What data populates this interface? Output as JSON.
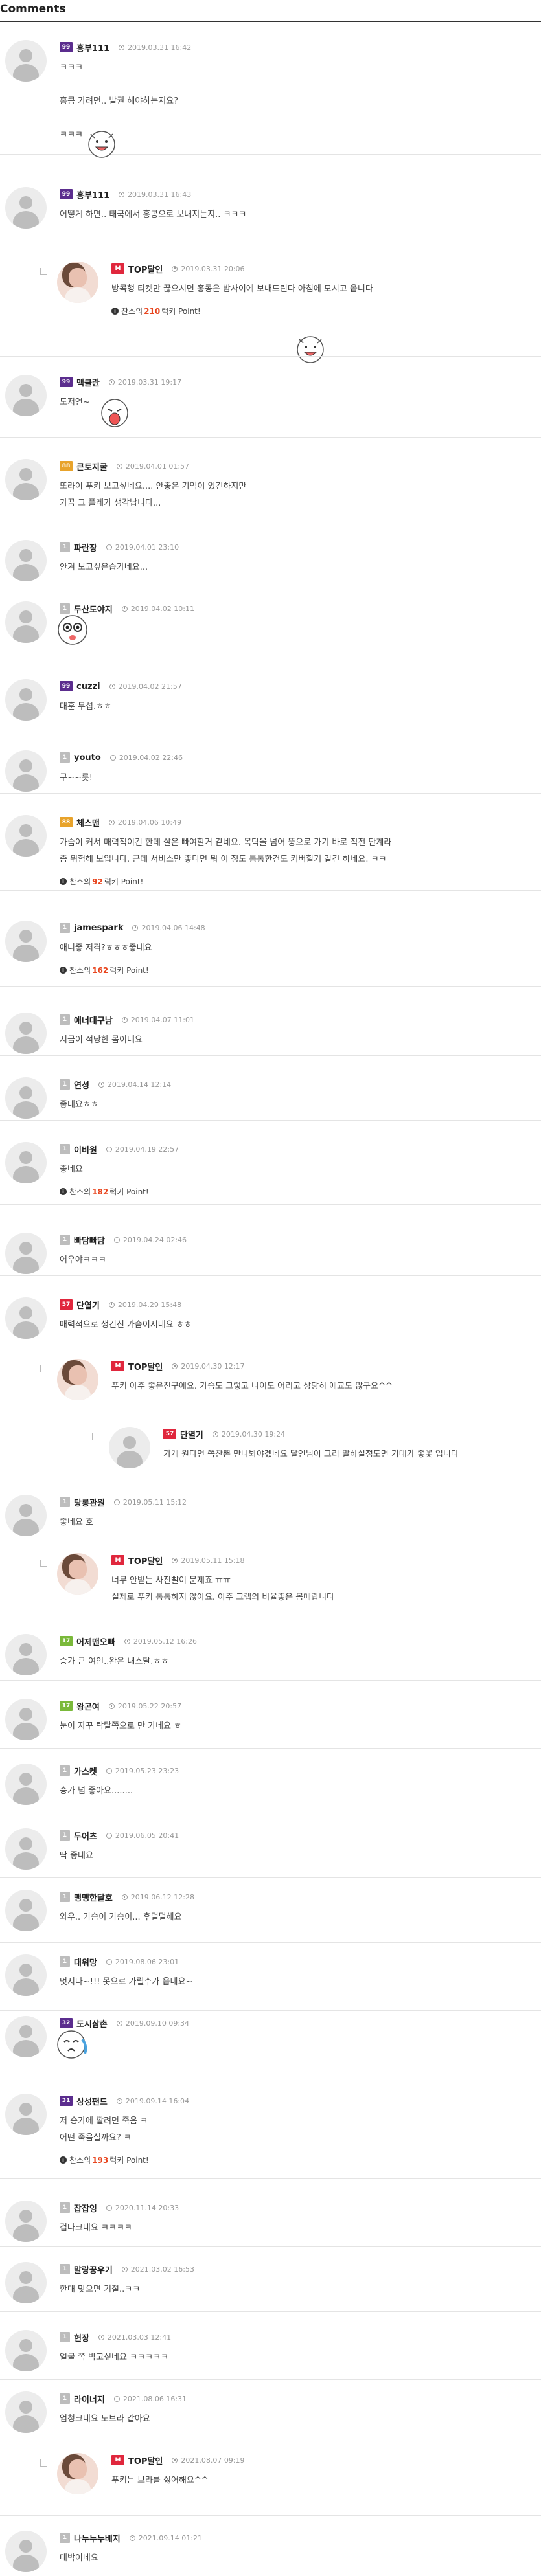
{
  "section_title": "Comments",
  "point_template": {
    "prefix": "찬스의",
    "suffix": "럭키 Point!"
  },
  "level_colors": {
    "99": "#5b2d8e",
    "M": "#e0273d",
    "88": "#e8a32b",
    "57": "#e0273d",
    "17": "#7ab93a",
    "32": "#5b2d8e",
    "31": "#5b2d8e",
    "1": "#bdbdbd"
  },
  "comments": [
    {
      "level": "99",
      "nick": "흥부111",
      "date": "2019.03.31 16:42",
      "lines": [
        "ㅋㅋㅋ",
        "",
        "홍콩 가려면.. 발권 해야하는지요?",
        "",
        "ㅋㅋㅋ"
      ],
      "emoji": "laughing-emoticon"
    },
    {
      "level": "99",
      "nick": "흥부111",
      "date": "2019.03.31 16:43",
      "lines": [
        "어떻게 하면.. 태국에서 홍콩으로 보내지는지.. ㅋㅋㅋ"
      ],
      "emoji": "laughing-emoticon"
    },
    {
      "level": "M",
      "nick": "TOP달인",
      "date": "2019.03.31 20:06",
      "lines": [
        "방콕행 티켓만 끊으시면 홍콩은 밤사이에 보내드린다 아침에 모시고 옵니다"
      ],
      "point": 210
    },
    {
      "level": "99",
      "nick": "맥클란",
      "date": "2019.03.31 19:17",
      "lines": [
        "도저언~"
      ],
      "emoji": "shouting-emoticon"
    },
    {
      "level": "88",
      "nick": "큰토지굴",
      "date": "2019.04.01 01:57",
      "lines": [
        "또라이 푸키 보고싶네요.... 안좋은 기억이 있긴하지만",
        "가끔 그 플레가 생각납니다..."
      ]
    },
    {
      "level": "1",
      "nick": "파란장",
      "date": "2019.04.01 23:10",
      "lines": [
        "안겨 보고싶은습가네요..."
      ]
    },
    {
      "level": "1",
      "nick": "두산도야지",
      "date": "2019.04.02 10:11",
      "lines": [],
      "emoji": "surprised-emoticon"
    },
    {
      "level": "99",
      "nick": "cuzzi",
      "date": "2019.04.02 21:57",
      "lines": [
        "대훈 무섭.ㅎㅎ"
      ]
    },
    {
      "level": "1",
      "nick": "youto",
      "date": "2019.04.02 22:46",
      "lines": [
        "구~~릇!"
      ]
    },
    {
      "level": "88",
      "nick": "체스맨",
      "date": "2019.04.06 10:49",
      "lines": [
        "가슴이 커서 매력적이긴 한데 살은 빠여할거 같네요. 목탁을 넘어 뚱으로 가기 바로 직전 단계라",
        "좀 위험해 보입니다. 근데 서비스만 좋다면 뭐 이 정도 통통한건도 커버할거 같긴 하네요. ㅋㅋ"
      ],
      "point": 92
    },
    {
      "level": "1",
      "nick": "jamespark",
      "date": "2019.04.06 14:48",
      "lines": [
        "애니좋 저격?ㅎㅎㅎ좋네요"
      ],
      "point": 162
    },
    {
      "level": "1",
      "nick": "애너대구남",
      "date": "2019.04.07 11:01",
      "lines": [
        "지금이 적당한 몸이네요"
      ]
    },
    {
      "level": "1",
      "nick": "연성",
      "date": "2019.04.14 12:14",
      "lines": [
        "좋네요ㅎㅎ"
      ]
    },
    {
      "level": "1",
      "nick": "이비원",
      "date": "2019.04.19 22:57",
      "lines": [
        "좋네요"
      ],
      "point": 182
    },
    {
      "level": "1",
      "nick": "빠담빠담",
      "date": "2019.04.24 02:46",
      "lines": [
        "어우야ㅋㅋㅋ"
      ]
    },
    {
      "level": "57",
      "nick": "단열기",
      "date": "2019.04.29 15:48",
      "lines": [
        "매력적으로 생긴신 가슴이시네요 ㅎㅎ"
      ]
    },
    {
      "level": "M",
      "nick": "TOP달인",
      "date": "2019.04.30 12:17",
      "lines": [
        "푸키 아주 좋은친구에요. 가슴도 그렇고 나이도 어리고 상당히 애교도 많구요^^"
      ]
    },
    {
      "level": "57",
      "nick": "단열기",
      "date": "2019.04.30 19:24",
      "lines": [
        "가게 원다면 쪽찬뽄 만나봐야겠네요 달인님이 그리 말하실정도면 기대가 좋꽃 입니다"
      ]
    },
    {
      "level": "1",
      "nick": "탕롱관원",
      "date": "2019.05.11 15:12",
      "lines": [
        "좋네요 호"
      ]
    },
    {
      "level": "M",
      "nick": "TOP달인",
      "date": "2019.05.11 15:18",
      "lines": [
        "너무 안받는 사진빨이 문제죠 ㅠㅠ",
        "실제로 푸키 통통하지 않아요. 아주 그랩의 비율좋은 몸매랍니다"
      ]
    },
    {
      "level": "17",
      "nick": "어제맨오빠",
      "date": "2019.05.12 16:26",
      "lines": [
        "승가 큰 여인..완은 내스탈.ㅎㅎ"
      ]
    },
    {
      "level": "17",
      "nick": "왕곤여",
      "date": "2019.05.22 20:57",
      "lines": [
        "눈이 자꾸 탁탈쪽으로 만 가네요 ㅎ"
      ]
    },
    {
      "level": "1",
      "nick": "가스켓",
      "date": "2019.05.23 23:23",
      "lines": [
        "승가 넘 좋아요........"
      ]
    },
    {
      "level": "1",
      "nick": "두어츠",
      "date": "2019.06.05 20:41",
      "lines": [
        "딱 좋네요"
      ]
    },
    {
      "level": "1",
      "nick": "맹맹한달호",
      "date": "2019.06.12 12:28",
      "lines": [
        "와우.. 가슴이 가슴이... 후덜덜해요"
      ]
    },
    {
      "level": "1",
      "nick": "대워망",
      "date": "2019.08.06 23:01",
      "lines": [
        "멋지다~!!! 못으로 가릴수가 읍네요~"
      ]
    },
    {
      "level": "32",
      "nick": "도시삼촌",
      "date": "2019.09.10 09:34",
      "lines": [],
      "emoji": "crying-emoticon"
    },
    {
      "level": "31",
      "nick": "상성팬드",
      "date": "2019.09.14 16:04",
      "lines": [
        "저 승가에 깔려면 죽음 ㅋ",
        "어떤 죽음실까요? ㅋ"
      ],
      "point": 193
    },
    {
      "level": "1",
      "nick": "잡잡잉",
      "date": "2020.11.14 20:33",
      "lines": [
        "겁나크네요 ㅋㅋㅋㅋ"
      ]
    },
    {
      "level": "1",
      "nick": "말랑꿍우기",
      "date": "2021.03.02 16:53",
      "lines": [
        "한대 맞으면 기절..ㅋㅋ"
      ]
    },
    {
      "level": "1",
      "nick": "현장",
      "date": "2021.03.03 12:41",
      "lines": [
        "얼굴 쪽 박고싶네요 ㅋㅋㅋㅋㅋ"
      ]
    },
    {
      "level": "1",
      "nick": "라이너지",
      "date": "2021.08.06 16:31",
      "lines": [
        "엄청크네요 노브라 같아요"
      ]
    },
    {
      "level": "M",
      "nick": "TOP달인",
      "date": "2021.08.07 09:19",
      "lines": [
        "푸키는 브라를 싫어해요^^"
      ]
    },
    {
      "level": "1",
      "nick": "나누누누베지",
      "date": "2021.09.14 01:21",
      "lines": [
        "대박이네요"
      ]
    }
  ]
}
